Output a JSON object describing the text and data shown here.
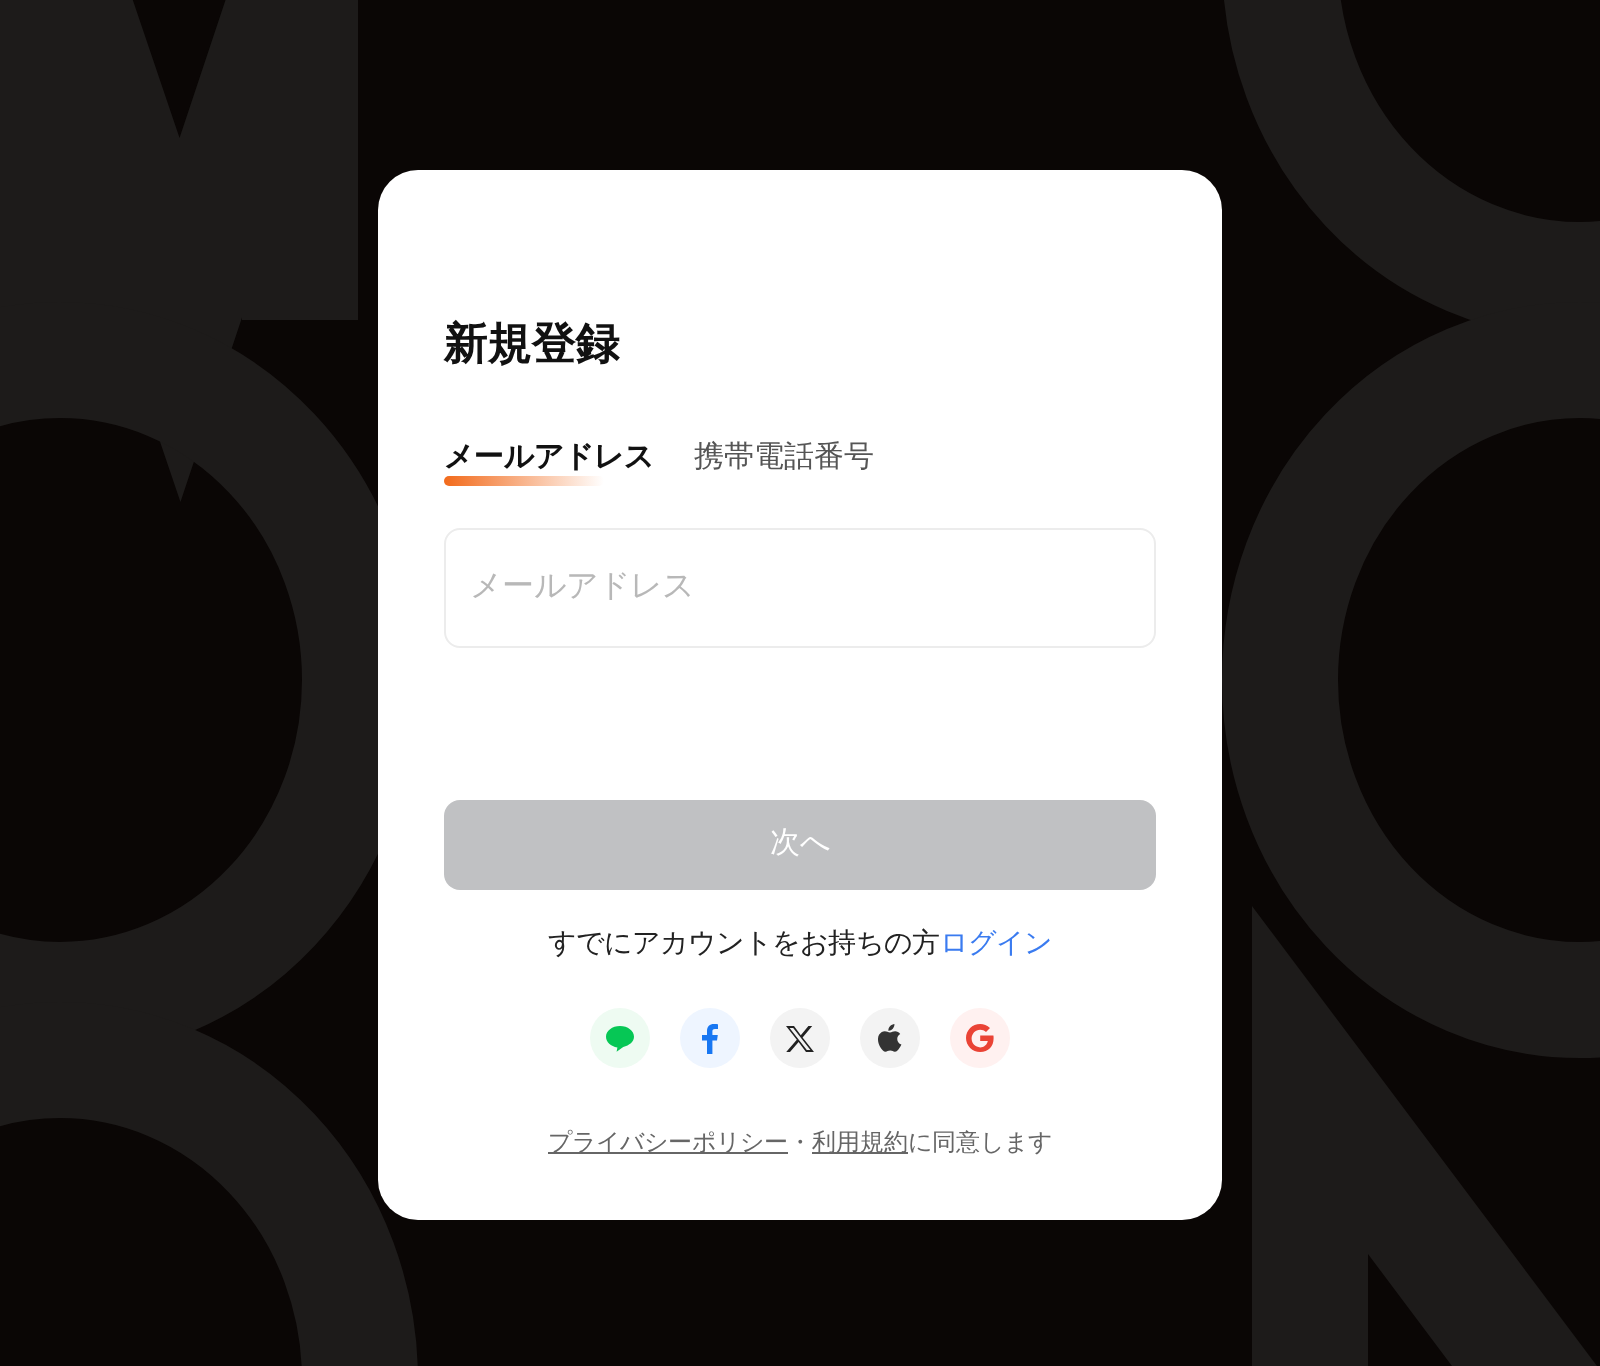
{
  "title": "新規登録",
  "tabs": [
    {
      "label": "メールアドレス",
      "selected": true
    },
    {
      "label": "携帯電話番号",
      "selected": false
    }
  ],
  "email_field": {
    "placeholder": "メールアドレス"
  },
  "next_button": {
    "label": "次へ",
    "disabled": true
  },
  "login_prompt": {
    "text": "すでにアカウントをお持ちの方",
    "link": "ログイン"
  },
  "social_logins": [
    {
      "kind": "line"
    },
    {
      "kind": "facebook"
    },
    {
      "kind": "x"
    },
    {
      "kind": "apple"
    },
    {
      "kind": "google"
    }
  ],
  "footer": {
    "privacy": "プライバシーポリシー",
    "separator": "・",
    "terms": "利用規約",
    "suffix": "に同意します"
  }
}
